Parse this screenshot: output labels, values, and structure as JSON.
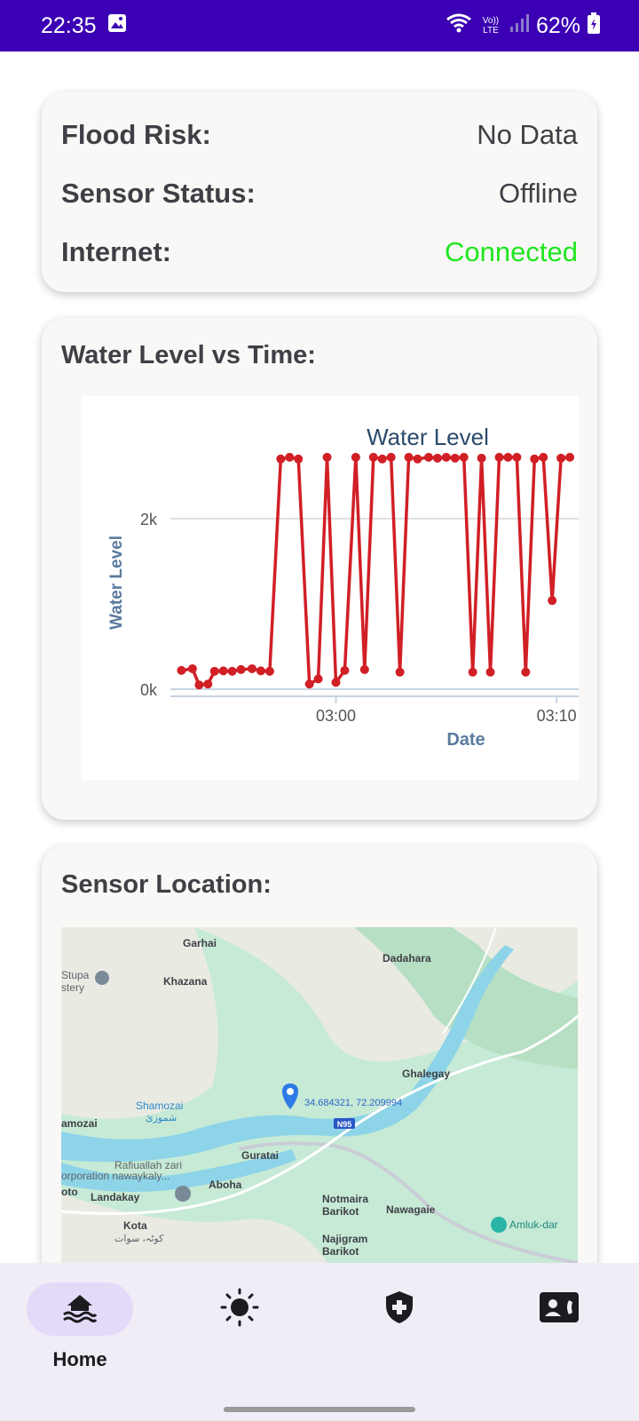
{
  "status_bar": {
    "time": "22:35",
    "battery": "62%",
    "network": "Vo)) LTE"
  },
  "status_card": {
    "rows": [
      {
        "label": "Flood Risk:",
        "value": "No Data"
      },
      {
        "label": "Sensor Status:",
        "value": "Offline"
      },
      {
        "label": "Internet:",
        "value": "Connected"
      }
    ]
  },
  "chart_card": {
    "title": "Water Level vs Time:"
  },
  "chart_data": {
    "type": "line",
    "title": "Water Level",
    "xlabel": "Date",
    "ylabel": "Water Level",
    "y_ticks": [
      "0k",
      "2k"
    ],
    "x_ticks": [
      "03:00",
      "03:10"
    ],
    "ylim": [
      0,
      2500
    ],
    "xlim_minutes": [
      52.5,
      71.0
    ],
    "x_tick_minutes": [
      60,
      70
    ],
    "series": [
      {
        "color": "#d11f26",
        "x": [
          53.0,
          53.5,
          53.8,
          54.2,
          54.5,
          54.9,
          55.3,
          55.7,
          56.2,
          56.6,
          57.0,
          57.5,
          57.9,
          58.3,
          58.8,
          59.2,
          59.6,
          60.0,
          60.4,
          60.9,
          61.3,
          61.7,
          62.1,
          62.5,
          62.9,
          63.3,
          63.7,
          64.2,
          64.6,
          65.0,
          65.4,
          65.8,
          66.2,
          66.6,
          67.0,
          67.4,
          67.8,
          68.2,
          68.6,
          69.0,
          69.4,
          69.8,
          70.2,
          70.6
        ],
        "y": [
          220,
          240,
          50,
          60,
          210,
          215,
          210,
          230,
          240,
          215,
          210,
          2700,
          2720,
          2700,
          60,
          120,
          2720,
          80,
          220,
          2720,
          230,
          2720,
          2700,
          2720,
          200,
          2720,
          2700,
          2720,
          2710,
          2720,
          2710,
          2720,
          200,
          2710,
          200,
          2720,
          2720,
          2720,
          200,
          2700,
          2720,
          1040,
          2710,
          2720
        ]
      }
    ],
    "grid": true
  },
  "location_card": {
    "title": "Sensor Location:",
    "map": {
      "marker_label": "34.684321, 72.209994",
      "road_label": "N95",
      "places": [
        "Garhai",
        "Dadahara",
        "Khazana",
        "Stupa",
        "stery",
        "Ghalegay",
        "Shamozai",
        "شموزئ",
        "amozai",
        "Guratai",
        "Rafiuallah zari",
        "orporation nawaykaly...",
        "oto",
        "Landakay",
        "Aboha",
        "Kota",
        "کوٹہ، سوات",
        "Notmaira",
        "Barikot",
        "Nawagaie",
        "Najigram",
        "Barikot",
        "Amluk-dar"
      ]
    }
  },
  "bottom_nav": {
    "items": [
      {
        "label": "Home"
      }
    ]
  },
  "colors": {
    "status_bar": "#3b00b3",
    "connected": "#1ee61e",
    "series": "#d11f26",
    "nav_active": "#e4daf8"
  },
  "icons": [
    "image-icon",
    "wifi-icon",
    "signal-icon",
    "battery-icon",
    "flood-icon",
    "sun-icon",
    "shield-plus-icon",
    "contact-icon",
    "location-pin-icon"
  ]
}
